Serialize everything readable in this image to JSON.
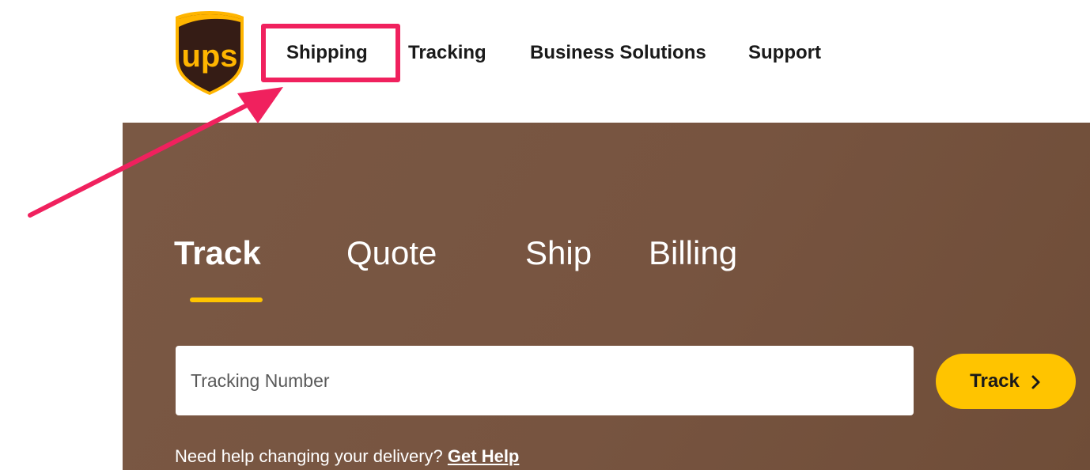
{
  "header": {
    "logo": {
      "text": "ups",
      "icon": "ups-shield-logo",
      "brand_color": "#351c15",
      "accent_color": "#ffb500"
    },
    "nav": [
      {
        "label": "Shipping"
      },
      {
        "label": "Tracking"
      },
      {
        "label": "Business Solutions"
      },
      {
        "label": "Support"
      }
    ]
  },
  "annotation": {
    "highlight_color": "#f0215e",
    "target": "Shipping"
  },
  "hero": {
    "background_color": "#775440",
    "tabs": [
      {
        "label": "Track",
        "active": true
      },
      {
        "label": "Quote"
      },
      {
        "label": "Ship"
      },
      {
        "label": "Billing"
      }
    ],
    "active_indicator_color": "#ffc400",
    "search": {
      "placeholder": "Tracking Number",
      "value": ""
    },
    "track_button": {
      "label": "Track",
      "icon": "chevron-right-icon",
      "color": "#ffc400"
    },
    "help": {
      "text": "Need help changing your delivery?",
      "link": "Get Help"
    }
  }
}
